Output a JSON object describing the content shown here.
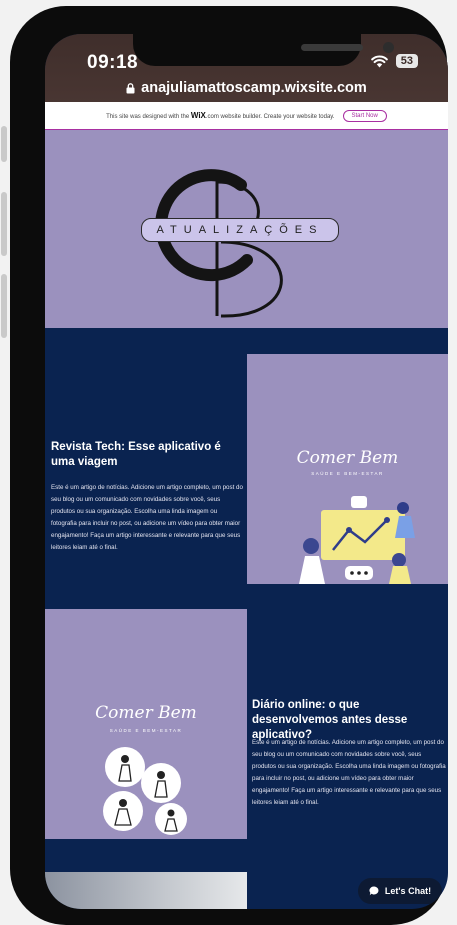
{
  "status_bar": {
    "time": "09:18",
    "battery": "53",
    "url": "anajuliamattoscamp.wixsite.com"
  },
  "wix_banner": {
    "text_before": "This site was designed with the",
    "brand": "WiX",
    "text_after": ".com website builder. Create your website today.",
    "cta": "Start Now"
  },
  "header": {
    "logo_letters": "CB",
    "logo_band": "ATUALIZAÇÕES"
  },
  "posts": [
    {
      "title": "Revista Tech: Esse aplicativo é uma viagem",
      "body": "Este é um artigo de notícias. Adicione um artigo completo, um post do seu blog ou um comunicado com novidades sobre você, seus produtos ou sua organização. Escolha uma linda imagem ou fotografia para incluir no post, ou adicione um vídeo para obter maior engajamento! Faça um artigo interessante e relevante para que seus leitores leiam até o final.",
      "image_title": "Comer Bem",
      "image_subtitle": "SAÚDE E BEM-ESTAR"
    },
    {
      "title": "Diário online: o que desenvolvemos antes desse aplicativo?",
      "body": "Este é um artigo de notícias. Adicione um artigo completo, um post do seu blog ou um comunicado com novidades sobre você, seus produtos ou sua organização. Escolha uma linda imagem ou fotografia para incluir no post, ou adicione um vídeo para obter maior engajamento! Faça um artigo interessante e relevante para que seus leitores leiam até o final.",
      "image_title": "Comer Bem",
      "image_subtitle": "SAÚDE E BEM-ESTAR"
    }
  ],
  "chat": {
    "label": "Let's Chat!"
  },
  "colors": {
    "lavender": "#9b91be",
    "navy": "#0a2350",
    "wix_accent": "#a82fa1"
  }
}
